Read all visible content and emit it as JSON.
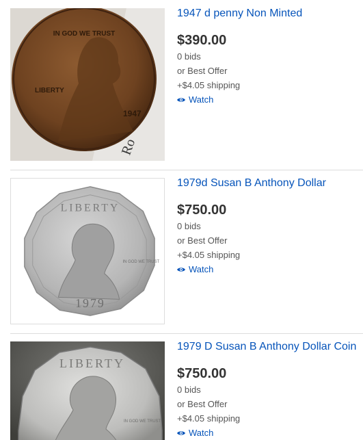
{
  "listings": [
    {
      "title": "1947 d penny Non Minted",
      "price": "$390.00",
      "bids": "0 bids",
      "offer": "or Best Offer",
      "shipping": "+$4.05 shipping",
      "watch": "Watch",
      "coin_text": {
        "top": "IN GOD WE TRUST",
        "left": "LIBERTY",
        "year": "1947"
      }
    },
    {
      "title": "1979d Susan B Anthony Dollar",
      "price": "$750.00",
      "bids": "0 bids",
      "offer": "or Best Offer",
      "shipping": "+$4.05 shipping",
      "watch": "Watch",
      "coin_text": {
        "top": "LIBERTY",
        "motto": "IN GOD WE TRUST",
        "year": "1979"
      }
    },
    {
      "title": "1979 D Susan B Anthony Dollar Coin",
      "price": "$750.00",
      "bids": "0 bids",
      "offer": "or Best Offer",
      "shipping": "+$4.05 shipping",
      "watch": "Watch",
      "coin_text": {
        "top": "LIBERTY",
        "motto": "IN GOD WE TRUST"
      }
    }
  ],
  "colors": {
    "link": "#0654ba",
    "price": "#333333",
    "meta": "#555555",
    "divider": "#dddddd",
    "penny": "#7a4a24",
    "silver": "#b9b9b9"
  },
  "icons": {
    "watch": "eye-icon"
  }
}
